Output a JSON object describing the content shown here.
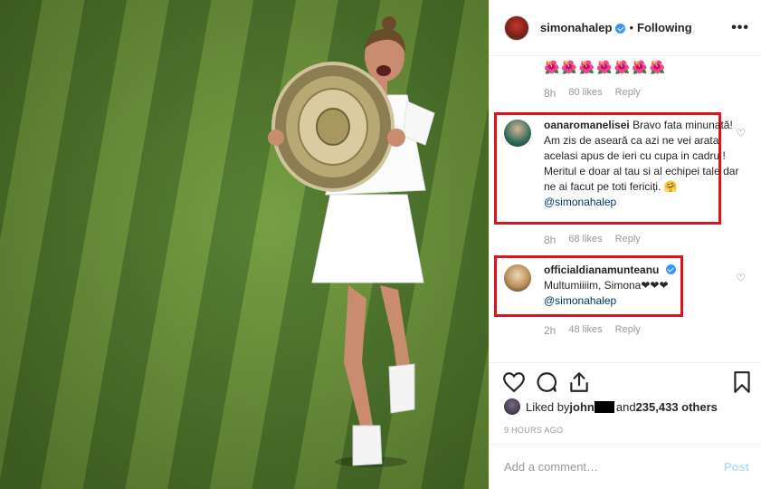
{
  "post": {
    "username": "simonahalep",
    "following_label": "Following",
    "dot": "•",
    "more_icon": "•••"
  },
  "comments": {
    "first": {
      "emojis": "🌺🌺🌺🌺🌺🌺🌺",
      "time": "8h",
      "likes": "80 likes",
      "reply": "Reply"
    },
    "second": {
      "username": "oanaromanelisei",
      "text": "Bravo fata minunată! Am zis de aseară ca azi ne vei arata acelasi apus de ieri cu cupa in cadru ! Meritul e doar al tau si al echipei tale dar ne ai facut pe toti fericiți. 🤗",
      "mention": "@simonahalep",
      "time": "8h",
      "likes": "68 likes",
      "reply": "Reply"
    },
    "third": {
      "username": "officialdianamunteanu",
      "text": "Multumiiiim, Simona❤❤❤",
      "mention": "@simonahalep",
      "time": "2h",
      "likes": "48 likes",
      "reply": "Reply"
    }
  },
  "likes_line": {
    "prefix": "Liked by ",
    "name": "john",
    "and": " and ",
    "count": "235,433 others"
  },
  "time_ago": "9 HOURS AGO",
  "add_comment": {
    "placeholder": "Add a comment…",
    "post_label": "Post"
  },
  "colors": {
    "highlight": "#d9151d",
    "verified": "#3897f0",
    "mention": "#003569",
    "post_disabled": "#b2dffc"
  }
}
